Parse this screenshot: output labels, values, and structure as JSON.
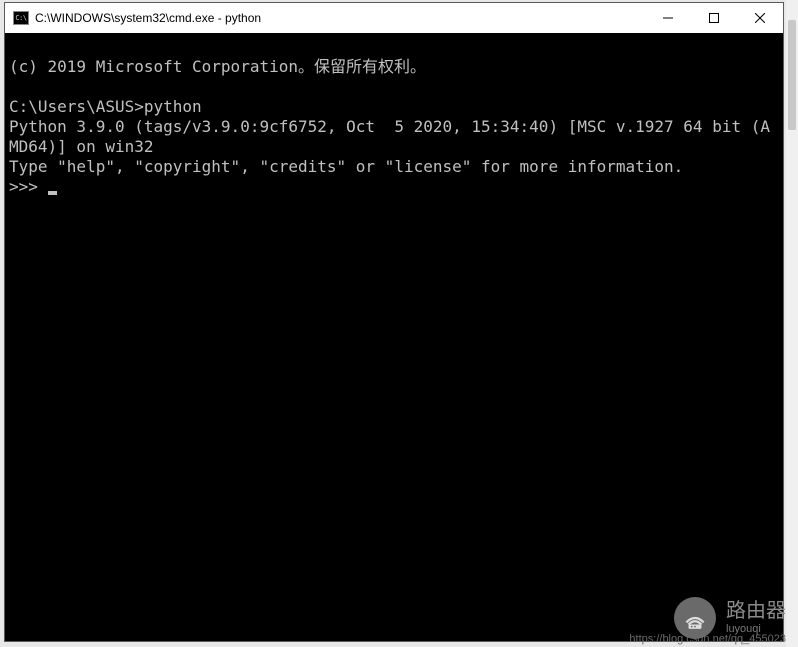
{
  "window": {
    "title": "C:\\WINDOWS\\system32\\cmd.exe - python",
    "icon_label": "C:\\"
  },
  "terminal": {
    "copyright": "(c) 2019 Microsoft Corporation。保留所有权利。",
    "blank1": "",
    "prompt_line": "C:\\Users\\ASUS>python",
    "python_version": "Python 3.9.0 (tags/v3.9.0:9cf6752, Oct  5 2020, 15:34:40) [MSC v.1927 64 bit (AMD64)] on win32",
    "help_line": "Type \"help\", \"copyright\", \"credits\" or \"license\" for more information.",
    "repl_prompt": ">>> "
  },
  "watermark": {
    "title": "路由器",
    "sub": "luyouqi",
    "url": "https://blog.csdn.net/qq_455023"
  },
  "controls": {
    "minimize": "minimize",
    "maximize": "maximize",
    "close": "close"
  }
}
